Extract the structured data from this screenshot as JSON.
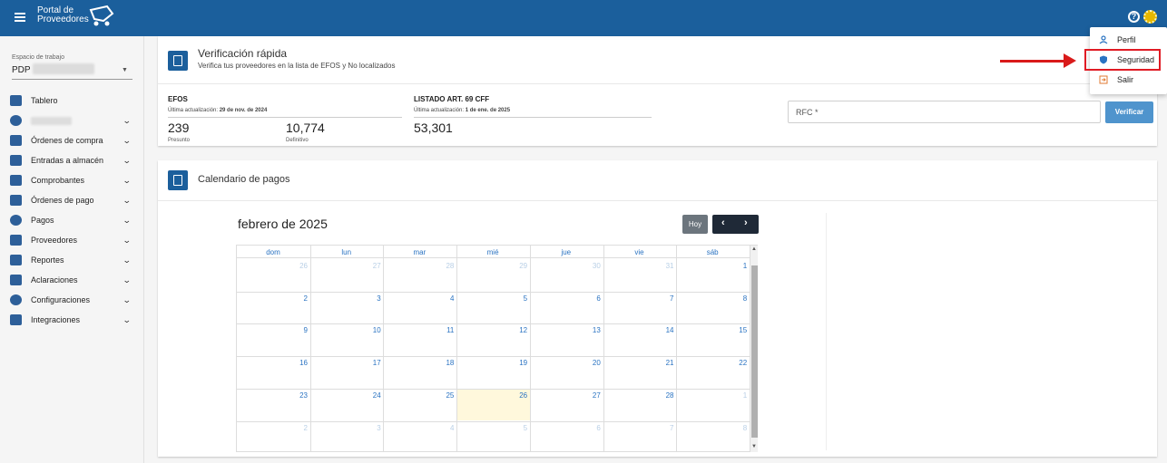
{
  "app": {
    "logo_line1": "Portal de",
    "logo_line2": "Proveedores"
  },
  "sidebar": {
    "workspace_label": "Espacio de trabajo",
    "workspace_value": "PDP",
    "items": [
      {
        "label": "Tablero",
        "icon": "dashboard-icon",
        "chevron": false
      },
      {
        "label": "",
        "icon": "dollar-icon",
        "chevron": true
      },
      {
        "label": "Órdenes de compra",
        "icon": "purchase-order-icon",
        "chevron": true
      },
      {
        "label": "Entradas a almacén",
        "icon": "truck-icon",
        "chevron": true
      },
      {
        "label": "Comprobantes",
        "icon": "document-icon",
        "chevron": true
      },
      {
        "label": "Órdenes de pago",
        "icon": "credit-card-icon",
        "chevron": true
      },
      {
        "label": "Pagos",
        "icon": "dollar-icon",
        "chevron": true
      },
      {
        "label": "Proveedores",
        "icon": "building-icon",
        "chevron": true
      },
      {
        "label": "Reportes",
        "icon": "chart-icon",
        "chevron": true
      },
      {
        "label": "Aclaraciones",
        "icon": "mail-icon",
        "chevron": true
      },
      {
        "label": "Configuraciones",
        "icon": "gear-icon",
        "chevron": true
      },
      {
        "label": "Integraciones",
        "icon": "puzzle-icon",
        "chevron": true
      }
    ]
  },
  "quick_verify": {
    "title": "Verificación rápida",
    "subtitle": "Verifica tus proveedores en la lista de EFOS y No localizados",
    "efos": {
      "title": "EFOS",
      "updated_label": "Última actualización:",
      "updated_date": "29 de nov. de 2024",
      "presunto_value": "239",
      "presunto_label": "Presunto",
      "definitivo_value": "10,774",
      "definitivo_label": "Definitivo"
    },
    "art69": {
      "title": "LISTADO ART. 69 CFF",
      "updated_label": "Última actualización:",
      "updated_date": "1 de ene. de 2025",
      "value": "53,301"
    },
    "rfc_placeholder": "RFC *",
    "verify_label": "Verificar"
  },
  "calendar": {
    "title": "Calendario de pagos",
    "month_label": "febrero de 2025",
    "today_label": "Hoy",
    "prev_label": "‹",
    "next_label": "›",
    "days_of_week": [
      "dom",
      "lun",
      "mar",
      "mié",
      "jue",
      "vie",
      "sáb"
    ],
    "weeks": [
      [
        "26",
        "27",
        "28",
        "29",
        "30",
        "31",
        "1"
      ],
      [
        "2",
        "3",
        "4",
        "5",
        "6",
        "7",
        "8"
      ],
      [
        "9",
        "10",
        "11",
        "12",
        "13",
        "14",
        "15"
      ],
      [
        "16",
        "17",
        "18",
        "19",
        "20",
        "21",
        "22"
      ],
      [
        "23",
        "24",
        "25",
        "26",
        "27",
        "28",
        "1"
      ],
      [
        "2",
        "3",
        "4",
        "5",
        "6",
        "7",
        "8"
      ]
    ],
    "today_date": "26"
  },
  "user_menu": {
    "items": [
      {
        "label": "Perfil",
        "icon": "person-icon"
      },
      {
        "label": "Seguridad",
        "icon": "shield-icon"
      },
      {
        "label": "Salir",
        "icon": "logout-icon"
      }
    ]
  },
  "colors": {
    "brand": "#1b5f9c",
    "accent": "#4f94cd",
    "today_bg": "#fff8dc",
    "annotation": "#d91a1a"
  }
}
